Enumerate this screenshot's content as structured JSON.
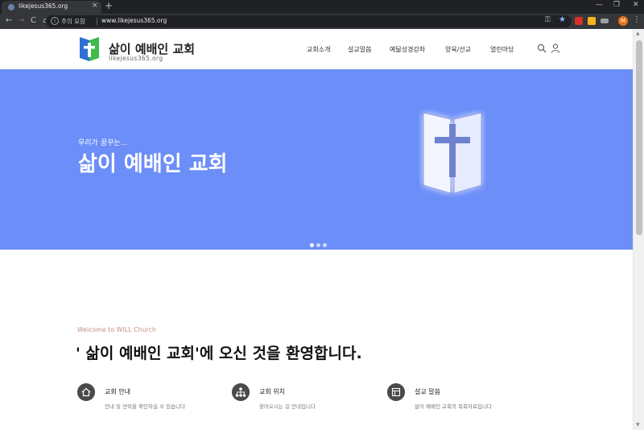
{
  "browser": {
    "tab_title": "likejesus365.org",
    "tab_close": "×",
    "new_tab": "+",
    "window_controls": [
      "—",
      "❐",
      "✕"
    ],
    "nav": {
      "back": "←",
      "forward": "→",
      "reload": "C",
      "home": "⌂"
    },
    "security_label": "주의 요함",
    "url": "www.likejesus365.org",
    "profile_initial": "M",
    "menu_glyph": "⋮"
  },
  "header": {
    "site_name": "삶이 예배인 교회",
    "site_domain": "likejesus365.org",
    "menu": [
      "교회소개",
      "설교말씀",
      "예닮성경강좌",
      "양육/선교",
      "열린마당"
    ]
  },
  "hero": {
    "kicker": "우리가 꿈꾸는...",
    "title": "삶이 예배인 교회",
    "slides": 3,
    "active_slide": 1,
    "bg_color": "#6c8ef8"
  },
  "welcome": {
    "kicker": "Welcome to WILL Church",
    "title": "' 삶이 예배인 교회'에 오신 것을 환영합니다."
  },
  "features": [
    {
      "icon": "home-icon",
      "title": "교회 안내",
      "desc": "안내 및 연혁을 확인하실 수 있습니다"
    },
    {
      "icon": "sitemap-icon",
      "title": "교회 위치",
      "desc": "찾아오시는 길 안내입니다"
    },
    {
      "icon": "book-icon",
      "title": "설교 말씀",
      "desc": "삶이 예배인 교회의 목회자료입니다"
    }
  ],
  "colors": {
    "accent": "#6c8ef8",
    "kicker": "#c68a7a",
    "logo_blue": "#2f6fd6",
    "logo_green": "#3dbb4a"
  }
}
